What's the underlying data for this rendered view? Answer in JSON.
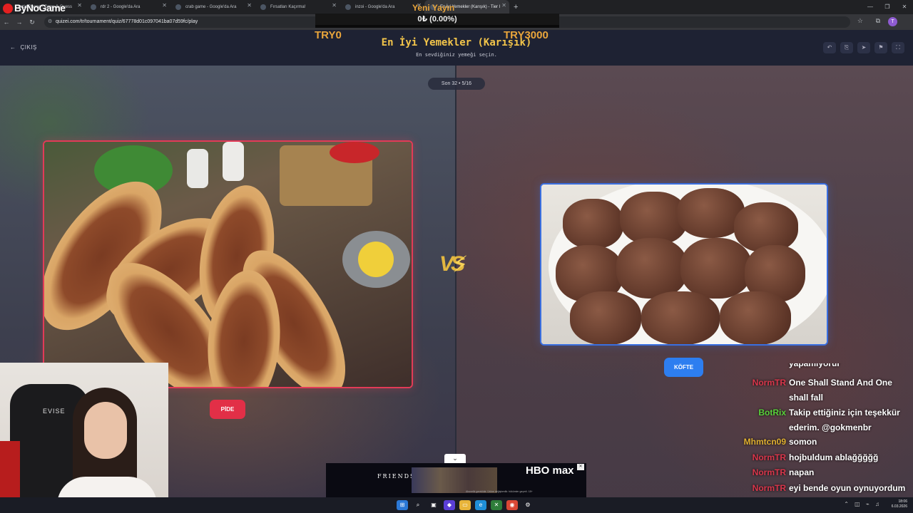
{
  "browser": {
    "tabs": [
      {
        "label": "Gartic Phone - Draw & Guess",
        "active": false
      },
      {
        "label": "rdr 2 - Google'da Ara",
        "active": false
      },
      {
        "label": "crab game - Google'da Ara",
        "active": false
      },
      {
        "label": "Fırsatları Kaçırma!",
        "active": false
      },
      {
        "label": "inzoi - Google'da Ara",
        "active": false
      },
      {
        "label": "En İyi Yemekler (Karışık) - Tier l",
        "active": true
      }
    ],
    "url": "quizei.com/tr/tournament/quiz/67778d01c097041ba07d59fc/play"
  },
  "header": {
    "back_label": "ÇIKIŞ",
    "title": "En İyi Yemekler (Karışık)",
    "subtitle": "En sevdiğiniz yemeği seçin."
  },
  "overlay": {
    "logo": "ByNoGame",
    "stream_title": "Yeni Yayın",
    "percent": "0₺ (0.00%)",
    "left_amount": "TRY0",
    "right_amount": "TRY3000"
  },
  "arena": {
    "round_badge": "Son 32 • 5/16",
    "vs": "VS",
    "left": {
      "label": "PİDE"
    },
    "right": {
      "label": "KÖFTE"
    }
  },
  "chat": [
    {
      "user": "",
      "msg": "yapamıyorur",
      "color": "#ffffff"
    },
    {
      "user": "NormTR",
      "msg": "One Shall Stand And One shall fall",
      "color": "#d9364b"
    },
    {
      "user": "BotRix",
      "msg": "Takip ettiğiniz için teşekkür ederim. @gokmenbr",
      "color": "#58d23a"
    },
    {
      "user": "Mhmtcn09",
      "msg": "somon",
      "color": "#e0b030"
    },
    {
      "user": "NormTR",
      "msg": "hojbuldum ablağğğğğ",
      "color": "#d9364b"
    },
    {
      "user": "NormTR",
      "msg": "napan",
      "color": "#d9364b"
    },
    {
      "user": "NormTR",
      "msg": "eyi bende oyun oynuyordum yaw",
      "color": "#d9364b"
    }
  ],
  "ad": {
    "show": "FRIENDS",
    "brand": "HBO max",
    "fine_print": "Abonelik gereklidir. Ürüne değişkenlik: hükümler geçerli. 18+"
  },
  "taskbar": {
    "time": "18:06",
    "date": "6.03.2026"
  },
  "colors": {
    "title": "#f3c54a",
    "left_accent": "#e22f47",
    "right_accent": "#2d7ef0"
  }
}
